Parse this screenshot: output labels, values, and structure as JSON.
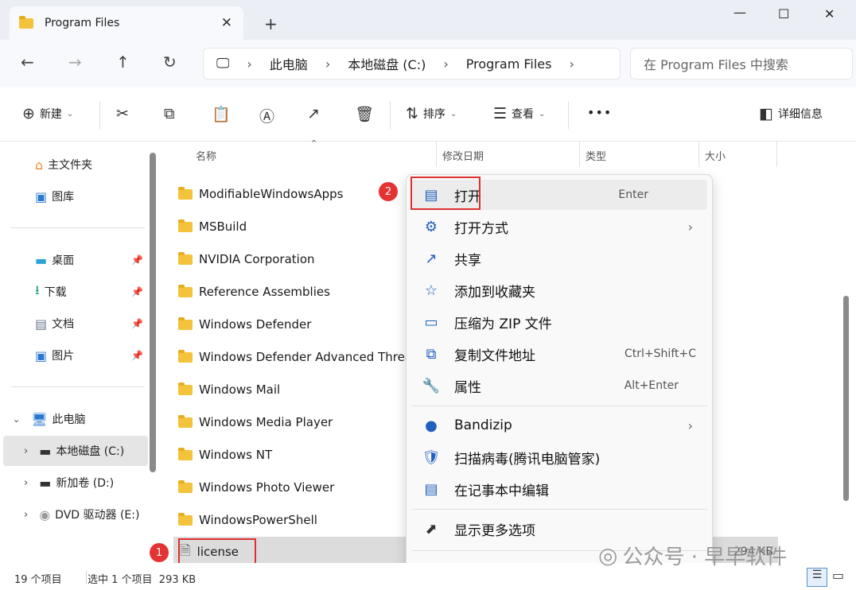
{
  "window": {
    "tab_title": "Program Files",
    "new_tab_symbol": "+",
    "minimize": "—",
    "maximize": "☐",
    "close": "✕"
  },
  "nav": {
    "breadcrumb": [
      "此电脑",
      "本地磁盘 (C:)",
      "Program Files"
    ],
    "search_placeholder": "在 Program Files 中搜索"
  },
  "commands": {
    "new_label": "新建",
    "sort_label": "排序",
    "view_label": "查看",
    "more_label": "•••",
    "details_label": "详细信息"
  },
  "sidebar": {
    "items": [
      {
        "label": "主文件夹"
      },
      {
        "label": "图库"
      },
      {
        "label": "桌面"
      },
      {
        "label": "下载"
      },
      {
        "label": "文档"
      },
      {
        "label": "图片"
      },
      {
        "label": "此电脑"
      },
      {
        "label": "本地磁盘 (C:)"
      },
      {
        "label": "新加卷 (D:)"
      },
      {
        "label": "DVD 驱动器 (E:)"
      }
    ]
  },
  "columns": {
    "name": "名称",
    "modified": "修改日期",
    "type": "类型",
    "size": "大小"
  },
  "files": [
    {
      "name": "ModifiableWindowsApps"
    },
    {
      "name": "MSBuild"
    },
    {
      "name": "NVIDIA Corporation"
    },
    {
      "name": "Reference Assemblies"
    },
    {
      "name": "Windows Defender"
    },
    {
      "name": "Windows Defender Advanced Threat Protection"
    },
    {
      "name": "Windows Mail"
    },
    {
      "name": "Windows Media Player"
    },
    {
      "name": "Windows NT"
    },
    {
      "name": "Windows Photo Viewer"
    },
    {
      "name": "WindowsPowerShell"
    },
    {
      "name": "license",
      "size": "294 KB"
    }
  ],
  "context_menu": {
    "items": [
      {
        "label": "打开",
        "shortcut": "Enter"
      },
      {
        "label": "打开方式"
      },
      {
        "label": "共享"
      },
      {
        "label": "添加到收藏夹"
      },
      {
        "label": "压缩为 ZIP 文件"
      },
      {
        "label": "复制文件地址",
        "shortcut": "Ctrl+Shift+C"
      },
      {
        "label": "属性",
        "shortcut": "Alt+Enter"
      },
      {
        "label": "Bandizip"
      },
      {
        "label": "扫描病毒(腾讯电脑管家)"
      },
      {
        "label": "在记事本中编辑"
      },
      {
        "label": "显示更多选项"
      }
    ]
  },
  "annotations": {
    "badge1": "1",
    "badge2": "2"
  },
  "status": {
    "item_count": "19 个项目",
    "selected": "选中 1 个项目  293 KB"
  },
  "watermark": "公众号 · 早早软件"
}
